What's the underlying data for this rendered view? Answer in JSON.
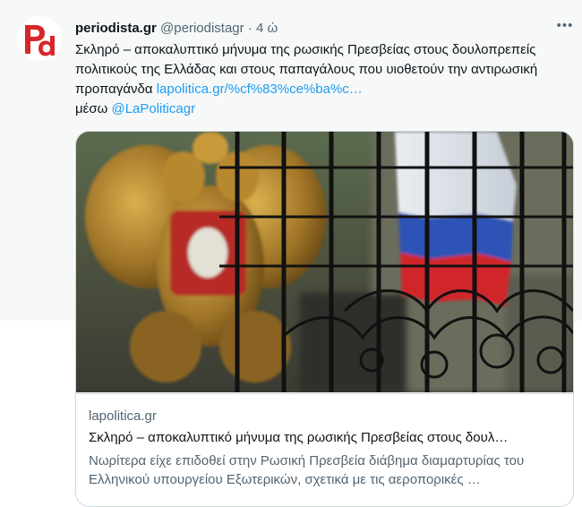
{
  "tweet": {
    "author_name": "periodista.gr",
    "author_handle": "@periodistagr",
    "separator": "·",
    "time": "4 ώ",
    "more_label": "•••",
    "text_main": "Σκληρό – αποκαλυπτικό μήνυμα της ρωσικής Πρεσβείας στους δουλοπρεπείς πολιτικούς της Ελλάδας και στους παπαγάλους που υιοθετούν την αντιρωσική προπαγάνδα ",
    "link_text": "lapolitica.gr/%cf%83%ce%ba%c…",
    "via_text": "μέσω ",
    "mention": "@LaPoliticagr"
  },
  "card": {
    "domain": "lapolitica.gr",
    "title": "Σκληρό – αποκαλυπτικό μήνυμα της ρωσικής Πρεσβείας στους δουλ…",
    "description": "Νωρίτερα είχε επιδοθεί στην Ρωσική Πρεσβεία διάβημα διαμαρτυρίας του Ελληνικού υπουργείου Εξωτερικών, σχετικά με τις αεροπορικές …",
    "image_alt": "Russian coat of arms and flag behind embassy fence"
  },
  "icons": {
    "avatar": "periodista-logo-icon",
    "more": "more-options-icon"
  },
  "colors": {
    "accent": "#1d9bf0",
    "logo_red": "#d7262b",
    "secondary_text": "#536471"
  }
}
